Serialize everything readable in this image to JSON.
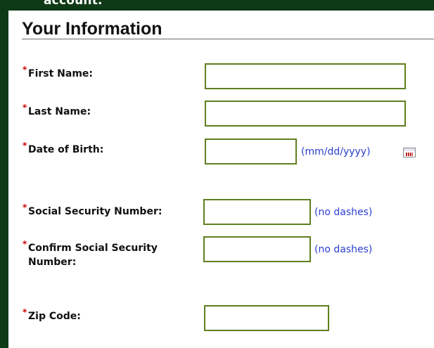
{
  "top_cut_text": "account.",
  "section": {
    "title": "Your Information"
  },
  "required_marker": "*",
  "fields": {
    "first_name": {
      "label": "First Name:",
      "value": ""
    },
    "last_name": {
      "label": "Last Name:",
      "value": ""
    },
    "dob": {
      "label": "Date of Birth:",
      "value": "",
      "hint": "(mm/dd/yyyy)"
    },
    "ssn": {
      "label": "Social Security Number:",
      "value": "",
      "hint": "(no dashes)"
    },
    "ssn_confirm": {
      "label": "Confirm Social Security Number:",
      "value": "",
      "hint": "(no dashes)"
    },
    "zip": {
      "label": "Zip Code:",
      "value": ""
    }
  },
  "colors": {
    "background": "#0e3a16",
    "input_border": "#5f7f1f",
    "required": "#cc0000",
    "hint": "#2b3fd0"
  }
}
